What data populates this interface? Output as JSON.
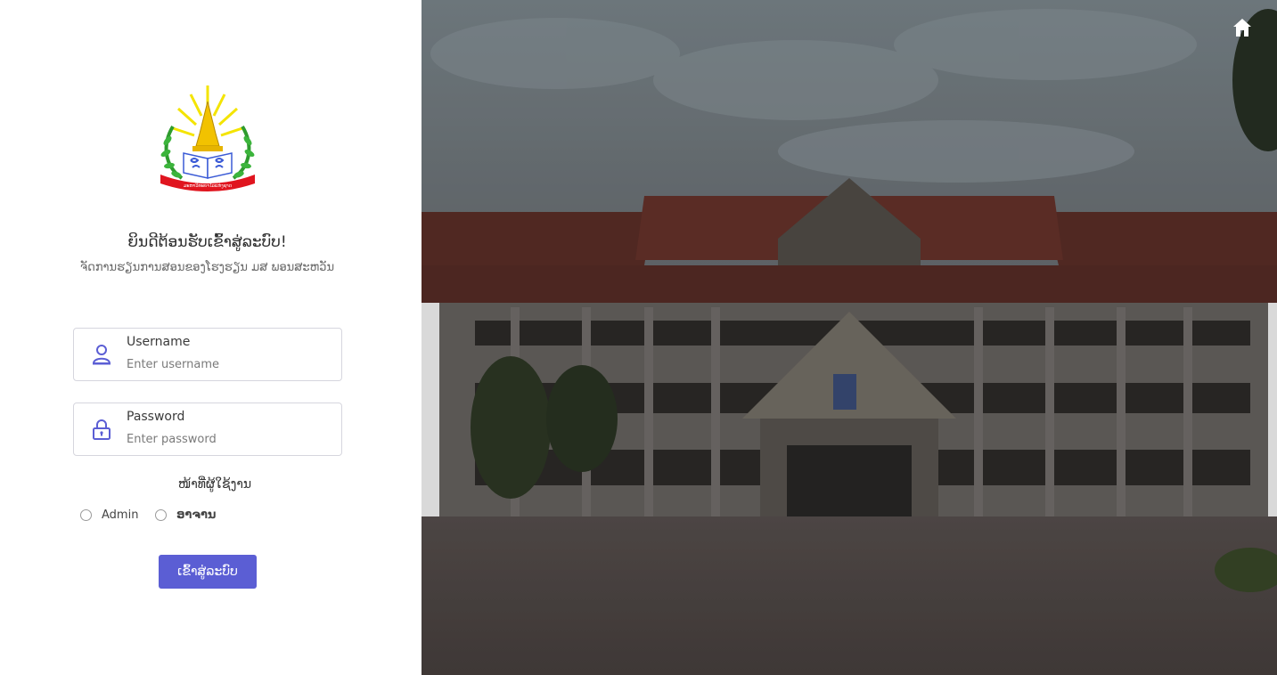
{
  "welcome": {
    "title": "ຍິນດີຕ້ອນຮັບເຂົ້າສູ່ລະບົບ!",
    "subtitle": "ຈັດການຮຽນການສອນຂອງໂຮງຮຽນ ມສ ພອນສະຫວັນ"
  },
  "logo": {
    "banner_text": "ມະຫາວິທະຍາໄລແຫ່ງຊາດ"
  },
  "username": {
    "label": "Username",
    "placeholder": "Enter username",
    "value": ""
  },
  "password": {
    "label": "Password",
    "placeholder": "Enter password",
    "value": ""
  },
  "role": {
    "label": "ໜ້າທີ່ຜູ້ໃຊ້ງານ",
    "options": [
      "Admin",
      "ອາຈານ"
    ]
  },
  "login_button": "ເຂົ້າສູ່ລະບົບ",
  "icons": {
    "user": "user-icon",
    "lock": "lock-icon",
    "home": "home-icon"
  },
  "colors": {
    "accent": "#5b5ed4",
    "icon": "#5b5ed4"
  }
}
